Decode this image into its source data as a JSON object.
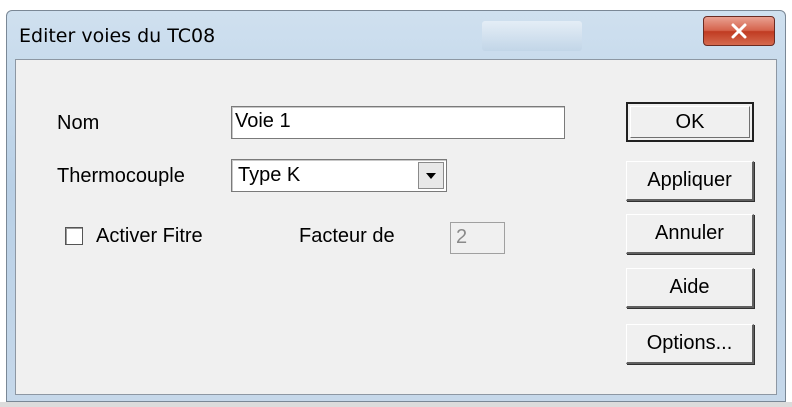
{
  "window": {
    "title": "Editer voies du TC08"
  },
  "title_bar_close_icon": "close-icon",
  "form": {
    "name_label": "Nom",
    "name_value": "Voie 1",
    "thermocouple_label": "Thermocouple",
    "thermocouple_value": "Type K",
    "filter_label": "Activer Fitre",
    "filter_checked": false,
    "factor_label": "Facteur de",
    "factor_value": "2"
  },
  "buttons": {
    "ok": "OK",
    "apply": "Appliquer",
    "cancel": "Annuler",
    "help": "Aide",
    "options": "Options..."
  }
}
